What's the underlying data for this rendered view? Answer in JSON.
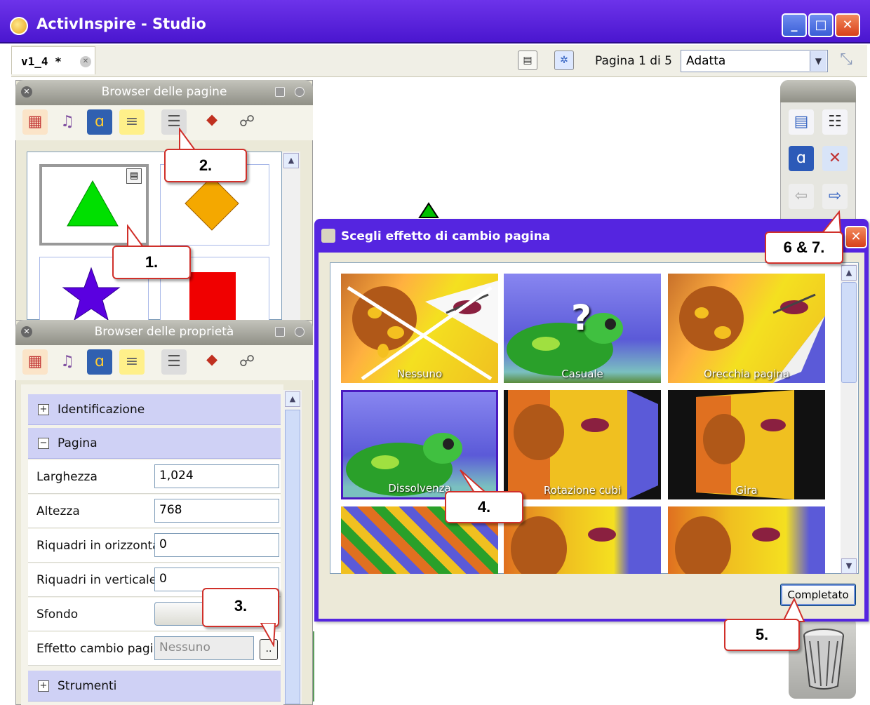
{
  "window": {
    "title": "ActivInspire - Studio",
    "min": "_",
    "max": "□",
    "close": "✕"
  },
  "toolbar": {
    "doc_tab": "v1_4 *",
    "doc_tab_close": "✕",
    "page_label": "Pagina 1 di 5",
    "zoom_value": "Adatta"
  },
  "page_browser": {
    "title": "Browser delle pagine",
    "close": "✕"
  },
  "property_browser": {
    "title": "Browser delle proprietà",
    "sections": {
      "identificazione": "Identificazione",
      "pagina": "Pagina",
      "strumenti": "Strumenti"
    },
    "signs": {
      "plus": "+",
      "minus": "−"
    },
    "rows": {
      "larghezza_label": "Larghezza",
      "larghezza_value": "1,024",
      "altezza_label": "Altezza",
      "altezza_value": "768",
      "riquadri_orizz_label": "Riquadri in orizzonta",
      "riquadri_orizz_value": "0",
      "riquadri_vert_label": "Riquadri in verticale",
      "riquadri_vert_value": "0",
      "sfondo_label": "Sfondo",
      "effetto_label": "Effetto cambio pagi",
      "effetto_value": "Nessuno",
      "effetto_button": ".."
    }
  },
  "dialog": {
    "title": "Scegli effetto di cambio pagina",
    "close": "✕",
    "done_button": "Completato",
    "effects": [
      "Nessuno",
      "Casuale",
      "Orecchia pagina",
      "Dissolvenza",
      "Rotazione cubi",
      "Gira",
      "",
      "",
      ""
    ]
  },
  "callouts": [
    "1.",
    "2.",
    "3.",
    "4.",
    "5.",
    "6 & 7."
  ],
  "icons": {
    "question": "?"
  }
}
